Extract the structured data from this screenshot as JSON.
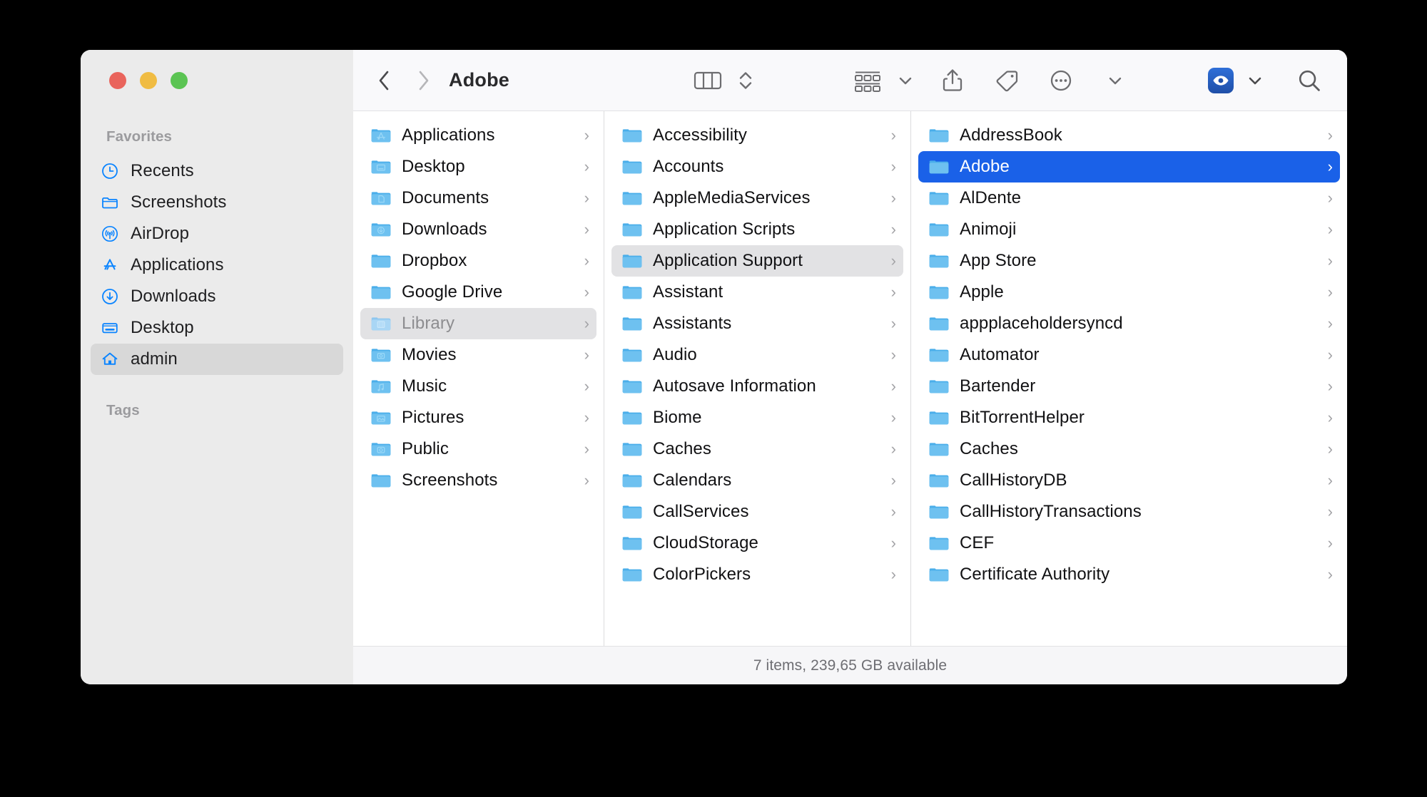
{
  "window": {
    "title": "Adobe",
    "traffic_lights": [
      "close",
      "minimize",
      "maximize"
    ],
    "accent_selected": "#1a61e8",
    "sidebar_bg": "#ebebeb"
  },
  "toolbar": {
    "back_label": "‹",
    "forward_label": "›",
    "title": "Adobe",
    "icons": [
      "column-view-icon",
      "view-stepper-icon",
      "group-by-icon",
      "chevron-down-icon",
      "share-icon",
      "tag-icon",
      "more-ellipsis-icon",
      "chevron-down-icon",
      "dropbox-eye-icon",
      "chevron-down-icon",
      "search-icon"
    ]
  },
  "sidebar": {
    "favorites_title": "Favorites",
    "tags_title": "Tags",
    "items": [
      {
        "label": "Recents",
        "icon": "clock-icon",
        "selected": false
      },
      {
        "label": "Screenshots",
        "icon": "folder-icon",
        "selected": false
      },
      {
        "label": "AirDrop",
        "icon": "airdrop-icon",
        "selected": false
      },
      {
        "label": "Applications",
        "icon": "appstore-icon",
        "selected": false
      },
      {
        "label": "Downloads",
        "icon": "download-icon",
        "selected": false
      },
      {
        "label": "Desktop",
        "icon": "desktop-icon",
        "selected": false
      },
      {
        "label": "admin",
        "icon": "home-icon",
        "selected": true
      }
    ]
  },
  "columns": [
    {
      "name": "home-column",
      "rows": [
        {
          "label": "Applications",
          "glyph": "appstore",
          "state": "normal"
        },
        {
          "label": "Desktop",
          "glyph": "desktop",
          "state": "normal"
        },
        {
          "label": "Documents",
          "glyph": "document",
          "state": "normal"
        },
        {
          "label": "Downloads",
          "glyph": "download",
          "state": "normal"
        },
        {
          "label": "Dropbox",
          "glyph": "plain",
          "state": "normal"
        },
        {
          "label": "Google Drive",
          "glyph": "plain",
          "state": "normal"
        },
        {
          "label": "Library",
          "glyph": "library",
          "state": "selected-dim"
        },
        {
          "label": "Movies",
          "glyph": "movies",
          "state": "normal"
        },
        {
          "label": "Music",
          "glyph": "music",
          "state": "normal"
        },
        {
          "label": "Pictures",
          "glyph": "pictures",
          "state": "normal"
        },
        {
          "label": "Public",
          "glyph": "public",
          "state": "normal"
        },
        {
          "label": "Screenshots",
          "glyph": "plain",
          "state": "normal"
        }
      ]
    },
    {
      "name": "library-column",
      "rows": [
        {
          "label": "Accessibility",
          "glyph": "plain",
          "state": "normal"
        },
        {
          "label": "Accounts",
          "glyph": "plain",
          "state": "normal"
        },
        {
          "label": "AppleMediaServices",
          "glyph": "plain",
          "state": "normal"
        },
        {
          "label": "Application Scripts",
          "glyph": "plain",
          "state": "normal"
        },
        {
          "label": "Application Support",
          "glyph": "plain",
          "state": "selected-gray"
        },
        {
          "label": "Assistant",
          "glyph": "plain",
          "state": "normal"
        },
        {
          "label": "Assistants",
          "glyph": "plain",
          "state": "normal"
        },
        {
          "label": "Audio",
          "glyph": "plain",
          "state": "normal"
        },
        {
          "label": "Autosave Information",
          "glyph": "plain",
          "state": "normal"
        },
        {
          "label": "Biome",
          "glyph": "plain",
          "state": "normal"
        },
        {
          "label": "Caches",
          "glyph": "plain",
          "state": "normal"
        },
        {
          "label": "Calendars",
          "glyph": "plain",
          "state": "normal"
        },
        {
          "label": "CallServices",
          "glyph": "plain",
          "state": "normal"
        },
        {
          "label": "CloudStorage",
          "glyph": "plain",
          "state": "normal"
        },
        {
          "label": "ColorPickers",
          "glyph": "plain",
          "state": "normal"
        }
      ]
    },
    {
      "name": "application-support-column",
      "rows": [
        {
          "label": "AddressBook",
          "glyph": "plain",
          "state": "normal"
        },
        {
          "label": "Adobe",
          "glyph": "plain",
          "state": "selected-blue"
        },
        {
          "label": "AlDente",
          "glyph": "plain",
          "state": "normal"
        },
        {
          "label": "Animoji",
          "glyph": "plain",
          "state": "normal"
        },
        {
          "label": "App Store",
          "glyph": "plain",
          "state": "normal"
        },
        {
          "label": "Apple",
          "glyph": "plain",
          "state": "normal"
        },
        {
          "label": "appplaceholdersyncd",
          "glyph": "plain",
          "state": "normal"
        },
        {
          "label": "Automator",
          "glyph": "plain",
          "state": "normal"
        },
        {
          "label": "Bartender",
          "glyph": "plain",
          "state": "normal"
        },
        {
          "label": "BitTorrentHelper",
          "glyph": "plain",
          "state": "normal"
        },
        {
          "label": "Caches",
          "glyph": "plain",
          "state": "normal"
        },
        {
          "label": "CallHistoryDB",
          "glyph": "plain",
          "state": "normal"
        },
        {
          "label": "CallHistoryTransactions",
          "glyph": "plain",
          "state": "normal"
        },
        {
          "label": "CEF",
          "glyph": "plain",
          "state": "normal"
        },
        {
          "label": "Certificate Authority",
          "glyph": "plain",
          "state": "normal"
        }
      ]
    }
  ],
  "status_bar": {
    "text": "7 items, 239,65 GB available"
  }
}
